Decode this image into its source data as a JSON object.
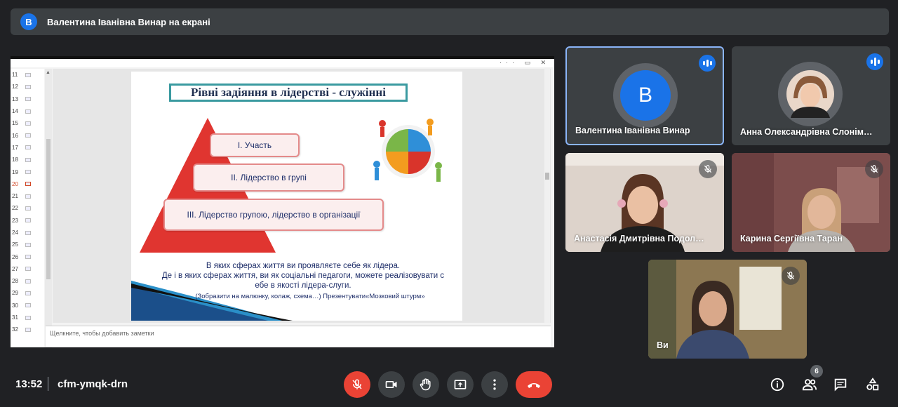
{
  "presenting_bar": {
    "avatar_letter": "В",
    "text": "Валентина Іванівна Винар на екрані"
  },
  "presentation": {
    "slide_numbers": [
      "11",
      "12",
      "13",
      "14",
      "15",
      "16",
      "17",
      "18",
      "19",
      "20",
      "21",
      "22",
      "23",
      "24",
      "25",
      "26",
      "27",
      "28",
      "29",
      "30",
      "31",
      "32"
    ],
    "current_slide": "20",
    "notes_placeholder": "Щелкните, чтобы добавить заметки",
    "slide": {
      "title": "Рівні задіяння в лідерстві - служінні",
      "level1": "I. Участь",
      "level2": "II. Лідерство в групі",
      "level3": "III. Лідерство групою, лідерство в організації",
      "text_line1": "В яких сферах життя ви проявляєте себе як лідера.",
      "text_line2": "Де і в яких сферах життя, ви як соціальні педагоги, можете реалізовувати с",
      "text_line3": "ебе в якості лідера-слуги.",
      "note_line": "(Зобразити на малюнку, колаж, схема…) Презентувати«Мозковий штурм»"
    }
  },
  "participants": [
    {
      "name": "Валентина Іванівна Винар",
      "avatar_letter": "В",
      "status": "speaking"
    },
    {
      "name": "Анна Олександрівна Слонім…",
      "status": "speaking"
    },
    {
      "name": "Анастасія Дмитрівна Подол…",
      "status": "muted"
    },
    {
      "name": "Карина Сергіївна Таран",
      "status": "muted"
    },
    {
      "name": "Ви",
      "status": "muted"
    }
  ],
  "bottom_bar": {
    "time": "13:52",
    "meeting_code": "cfm-ymqk-drn",
    "participants_count": "6",
    "icons": [
      "mic-off-icon",
      "camera-icon",
      "raise-hand-icon",
      "present-screen-icon",
      "more-options-icon",
      "end-call-icon",
      "info-icon",
      "people-icon",
      "chat-icon",
      "activities-icon"
    ]
  },
  "colors": {
    "background": "#202124",
    "surface": "#3c4043",
    "accent": "#1a73e8",
    "danger": "#ea4335",
    "active_border": "#8ab4f8"
  }
}
